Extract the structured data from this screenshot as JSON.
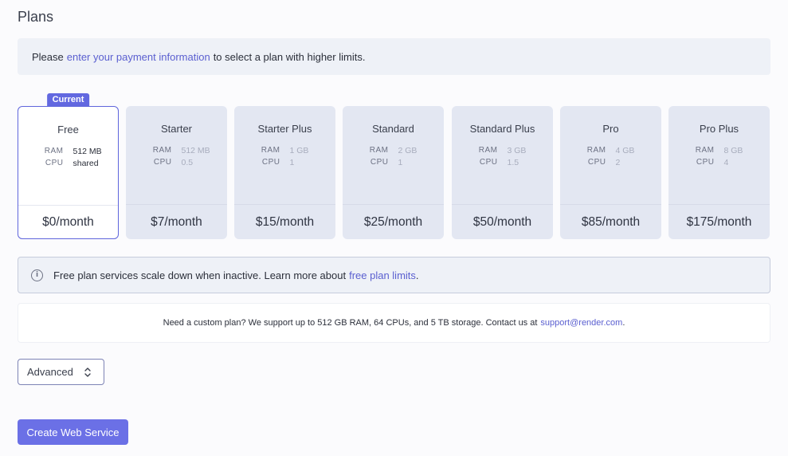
{
  "page": {
    "title": "Plans"
  },
  "payment_notice": {
    "prefix": "Please",
    "link": "enter your payment information",
    "suffix": "to select a plan with higher limits."
  },
  "plans": [
    {
      "name": "Free",
      "badge": "Current",
      "ram_label": "RAM",
      "ram": "512 MB",
      "cpu_label": "CPU",
      "cpu": "shared",
      "price": "$0/month"
    },
    {
      "name": "Starter",
      "ram_label": "RAM",
      "ram": "512 MB",
      "cpu_label": "CPU",
      "cpu": "0.5",
      "price": "$7/month"
    },
    {
      "name": "Starter Plus",
      "ram_label": "RAM",
      "ram": "1 GB",
      "cpu_label": "CPU",
      "cpu": "1",
      "price": "$15/month"
    },
    {
      "name": "Standard",
      "ram_label": "RAM",
      "ram": "2 GB",
      "cpu_label": "CPU",
      "cpu": "1",
      "price": "$25/month"
    },
    {
      "name": "Standard Plus",
      "ram_label": "RAM",
      "ram": "3 GB",
      "cpu_label": "CPU",
      "cpu": "1.5",
      "price": "$50/month"
    },
    {
      "name": "Pro",
      "ram_label": "RAM",
      "ram": "4 GB",
      "cpu_label": "CPU",
      "cpu": "2",
      "price": "$85/month"
    },
    {
      "name": "Pro Plus",
      "ram_label": "RAM",
      "ram": "8 GB",
      "cpu_label": "CPU",
      "cpu": "4",
      "price": "$175/month"
    }
  ],
  "free_info": {
    "icon": "info-icon",
    "text": "Free plan services scale down when inactive. Learn more about",
    "link": "free plan limits",
    "suffix": "."
  },
  "custom_plan": {
    "text": "Need a custom plan? We support up to 512 GB RAM, 64 CPUs, and 5 TB storage. Contact us at",
    "link": "support@render.com",
    "suffix": "."
  },
  "advanced": {
    "label": "Advanced",
    "icon": "chevron-up-down-icon"
  },
  "create_button": {
    "label": "Create Web Service"
  },
  "colors": {
    "accent": "#6b70e6",
    "link": "#5a5fd0",
    "card_bg": "#e3e7f2",
    "notice_bg": "#eef1f7"
  }
}
